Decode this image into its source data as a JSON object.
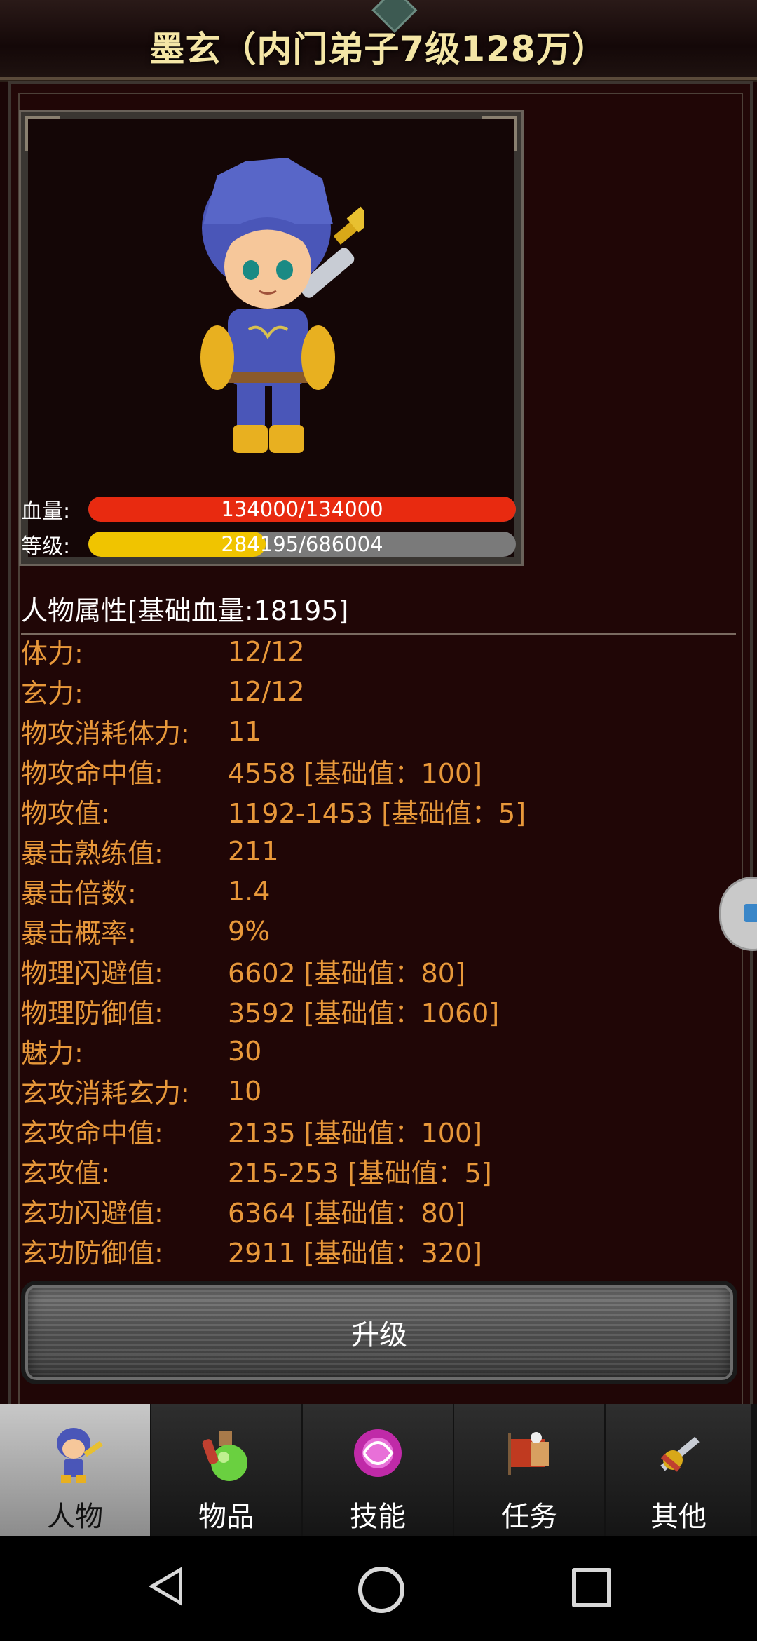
{
  "header": {
    "title": "墨玄（内门弟子7级128万）"
  },
  "character": {
    "hp": {
      "label": "血量:",
      "current": 134000,
      "max": 134000,
      "text": "134000/134000",
      "color": "#e82a10"
    },
    "level": {
      "label": "等级:",
      "current": 284195,
      "max": 686004,
      "text": "284195/686004",
      "color": "#f0c400"
    }
  },
  "attributes": {
    "heading": "人物属性[基础血量:18195]",
    "rows": [
      {
        "key": "体力:",
        "value": "12/12"
      },
      {
        "key": "玄力:",
        "value": "12/12"
      },
      {
        "key": "物攻消耗体力:",
        "value": "11"
      },
      {
        "key": "物攻命中值:",
        "value": "4558 [基础值：100]"
      },
      {
        "key": "物攻值:",
        "value": "1192-1453 [基础值：5]"
      },
      {
        "key": "暴击熟练值:",
        "value": "211"
      },
      {
        "key": "暴击倍数:",
        "value": "1.4"
      },
      {
        "key": "暴击概率:",
        "value": "9%"
      },
      {
        "key": "物理闪避值:",
        "value": "6602 [基础值：80]"
      },
      {
        "key": "物理防御值:",
        "value": "3592 [基础值：1060]"
      },
      {
        "key": "魅力:",
        "value": "30"
      },
      {
        "key": "玄攻消耗玄力:",
        "value": "10"
      },
      {
        "key": "玄攻命中值:",
        "value": "2135 [基础值：100]"
      },
      {
        "key": "玄攻值:",
        "value": "215-253 [基础值：5]"
      },
      {
        "key": "玄功闪避值:",
        "value": "6364 [基础值：80]"
      },
      {
        "key": "玄功防御值:",
        "value": "2911 [基础值：320]"
      }
    ],
    "text_color": "#e8983a"
  },
  "actions": {
    "upgrade_label": "升级"
  },
  "tabs": [
    {
      "label": "人物",
      "icon": "character-icon",
      "active": true
    },
    {
      "label": "物品",
      "icon": "potion-icon",
      "active": false
    },
    {
      "label": "技能",
      "icon": "skill-orb-icon",
      "active": false
    },
    {
      "label": "任务",
      "icon": "quest-flag-icon",
      "active": false
    },
    {
      "label": "其他",
      "icon": "crossed-swords-icon",
      "active": false
    }
  ],
  "navigation": {
    "icons": [
      "back-icon",
      "home-icon",
      "recents-icon"
    ]
  }
}
